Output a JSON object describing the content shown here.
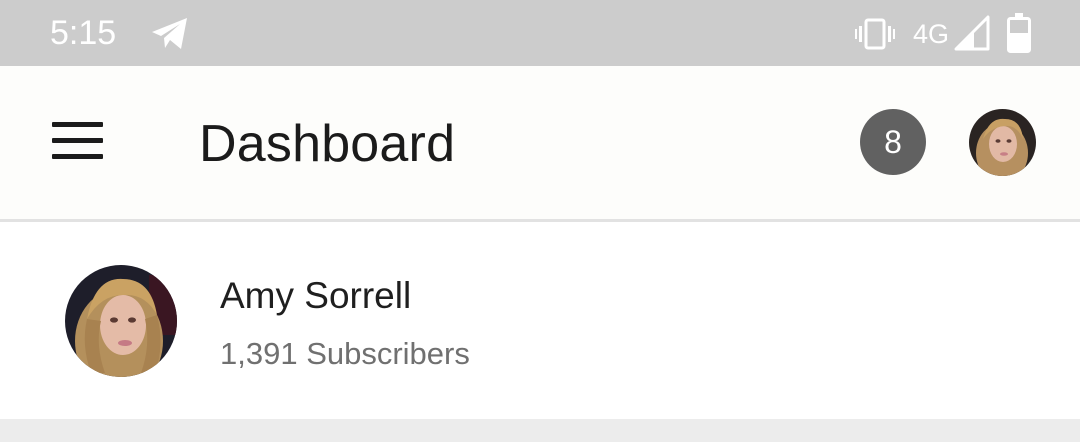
{
  "status_bar": {
    "time": "5:15",
    "network": "4G",
    "icons": [
      "telegram-icon",
      "vibrate-icon",
      "signal-icon",
      "battery-icon"
    ]
  },
  "app_bar": {
    "menu_icon": "hamburger-menu-icon",
    "title": "Dashboard",
    "notification_count": "8"
  },
  "channel": {
    "name": "Amy Sorrell",
    "subscribers": "1,391 Subscribers"
  },
  "colors": {
    "status_bar_bg": "#cccccc",
    "app_bar_bg": "#fdfdfb",
    "badge_bg": "#616161",
    "title_text": "#1b1b1b",
    "secondary_text": "#707070"
  }
}
